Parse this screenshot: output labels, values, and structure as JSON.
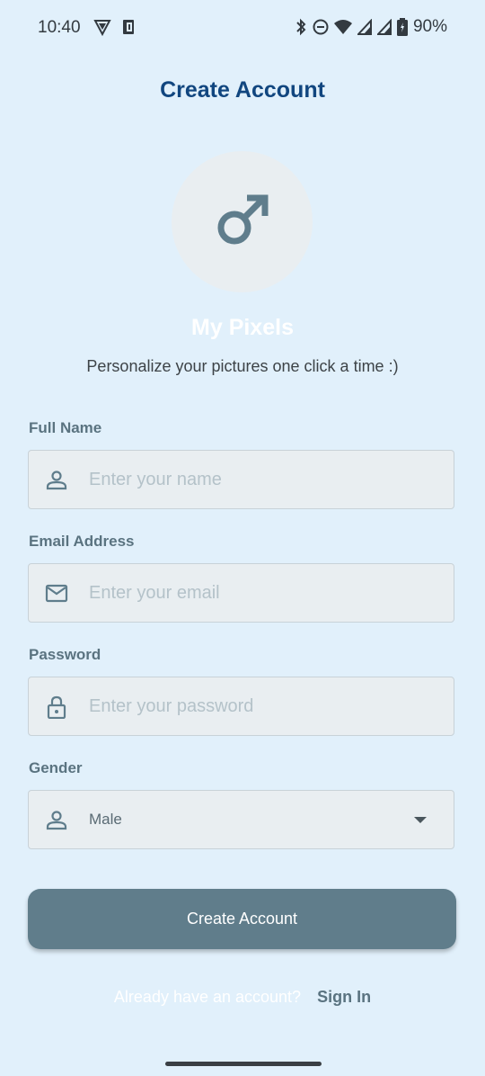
{
  "status_bar": {
    "time": "10:40",
    "battery_percent": "90%",
    "icons": [
      "shield-icon",
      "sim-card-icon",
      "bluetooth-icon",
      "do-not-disturb-icon",
      "wifi-icon",
      "signal-icon",
      "signal-icon",
      "battery-charging-icon"
    ]
  },
  "header": {
    "title": "Create Account"
  },
  "profile": {
    "avatar_icon": "male-symbol-icon",
    "app_name": "My Pixels",
    "tagline": "Personalize your pictures one click a time :)"
  },
  "form": {
    "full_name": {
      "label": "Full Name",
      "placeholder": "Enter your name",
      "value": "",
      "icon": "person-icon"
    },
    "email": {
      "label": "Email Address",
      "placeholder": "Enter your email",
      "value": "",
      "icon": "mail-icon"
    },
    "password": {
      "label": "Password",
      "placeholder": "Enter your password",
      "value": "",
      "icon": "lock-icon"
    },
    "gender": {
      "label": "Gender",
      "selected": "Male",
      "icon": "person-icon"
    },
    "submit_label": "Create Account"
  },
  "footer": {
    "prompt": "Already have an account?",
    "sign_in_label": "Sign In"
  },
  "colors": {
    "background": "#E1F0FB",
    "title": "#11467f",
    "button": "#607D8B",
    "field_background": "#E9EEF1",
    "label": "#5a7380"
  }
}
